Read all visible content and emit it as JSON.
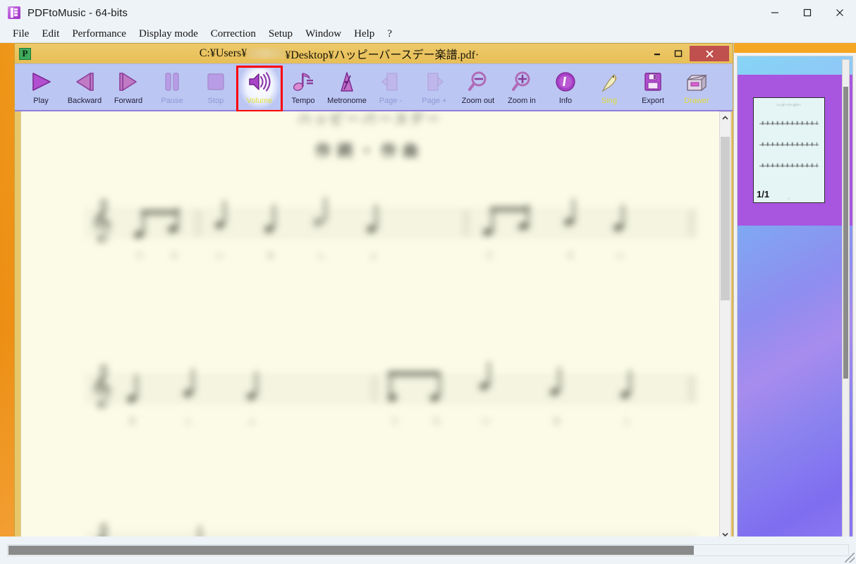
{
  "app": {
    "title": "PDFtoMusic - 64-bits",
    "icon": "pdftomusic-icon"
  },
  "window_controls": {
    "minimize": "—",
    "maximize": "□",
    "close": "✕"
  },
  "menubar": {
    "items": [
      {
        "label": "File"
      },
      {
        "label": "Edit"
      },
      {
        "label": "Performance"
      },
      {
        "label": "Display mode"
      },
      {
        "label": "Correction"
      },
      {
        "label": "Setup"
      },
      {
        "label": "Window"
      },
      {
        "label": "Help"
      },
      {
        "label": "?"
      }
    ]
  },
  "document_window": {
    "icon_letter": "P",
    "title_prefix": "C:¥Users¥",
    "title_suffix": "¥Desktop¥ハッピーバースデー楽譜.pdf·",
    "minimize": "–",
    "maximize": "□",
    "close": "✕"
  },
  "toolbar": {
    "buttons": [
      {
        "label": "Play",
        "icon": "play-icon",
        "state": "enabled"
      },
      {
        "label": "Backward",
        "icon": "backward-icon",
        "state": "enabled"
      },
      {
        "label": "Forward",
        "icon": "forward-icon",
        "state": "enabled"
      },
      {
        "label": "Pause",
        "icon": "pause-icon",
        "state": "disabled"
      },
      {
        "label": "Stop",
        "icon": "stop-icon",
        "state": "disabled"
      },
      {
        "label": "Volume",
        "icon": "volume-icon",
        "state": "highlighted"
      },
      {
        "label": "Tempo",
        "icon": "tempo-note-icon",
        "state": "enabled"
      },
      {
        "label": "Metronome",
        "icon": "metronome-icon",
        "state": "enabled"
      },
      {
        "label": "Page -",
        "icon": "page-prev-icon",
        "state": "disabled"
      },
      {
        "label": "Page +",
        "icon": "page-next-icon",
        "state": "disabled"
      },
      {
        "label": "Zoom out",
        "icon": "zoom-out-icon",
        "state": "enabled"
      },
      {
        "label": "Zoom in",
        "icon": "zoom-in-icon",
        "state": "enabled"
      },
      {
        "label": "Info",
        "icon": "info-icon",
        "state": "enabled"
      },
      {
        "label": "Sing",
        "icon": "bird-sing-icon",
        "state": "yellow"
      },
      {
        "label": "Export",
        "icon": "floppy-save-icon",
        "state": "enabled"
      },
      {
        "label": "Drawer",
        "icon": "drawer-icon",
        "state": "yellow"
      }
    ],
    "highlight_color": "#ff0000"
  },
  "sheet": {
    "title_line1": "ハッピーバースデー",
    "title_line2": "作詞・作曲",
    "lyrics": [
      "う",
      "た",
      "い",
      "ま",
      "し",
      "ょ",
      "う"
    ]
  },
  "thumbnail_panel": {
    "page_label": "1/1",
    "selection_color": "#a855e0"
  },
  "colors": {
    "toolbar_bg": "#bcc6f2",
    "doc_titlebar": "#e8c76b",
    "mdi_bg": "#f5a623",
    "page_bg": "#fbfbe8",
    "highlight": "#ff0000",
    "yellow_label": "#dede3a"
  }
}
